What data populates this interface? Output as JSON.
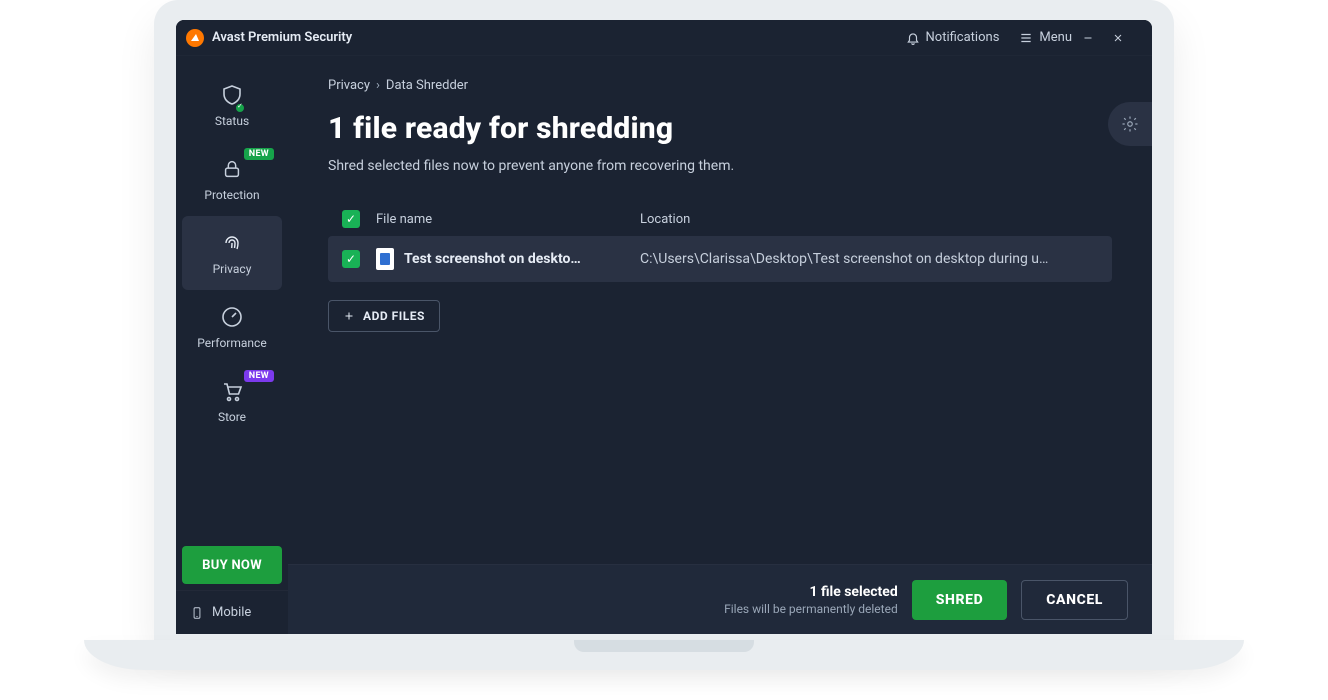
{
  "titlebar": {
    "app_name": "Avast Premium Security",
    "notifications": "Notifications",
    "menu": "Menu"
  },
  "sidebar": {
    "items": [
      {
        "label": "Status"
      },
      {
        "label": "Protection",
        "badge": "NEW"
      },
      {
        "label": "Privacy"
      },
      {
        "label": "Performance"
      },
      {
        "label": "Store",
        "badge": "NEW"
      }
    ],
    "buy_label": "BUY NOW",
    "mobile_label": "Mobile"
  },
  "breadcrumb": {
    "root": "Privacy",
    "leaf": "Data Shredder"
  },
  "page": {
    "title": "1 file ready for shredding",
    "subtitle": "Shred selected files now to prevent anyone from recovering them."
  },
  "table": {
    "headers": {
      "filename": "File name",
      "location": "Location"
    },
    "rows": [
      {
        "name": "Test screenshot on deskto…",
        "location": "C:\\Users\\Clarissa\\Desktop\\Test screenshot on desktop during u…"
      }
    ],
    "add_files": "ADD FILES"
  },
  "footer": {
    "selected": "1 file selected",
    "warning": "Files will be permanently deleted",
    "shred": "SHRED",
    "cancel": "CANCEL"
  }
}
